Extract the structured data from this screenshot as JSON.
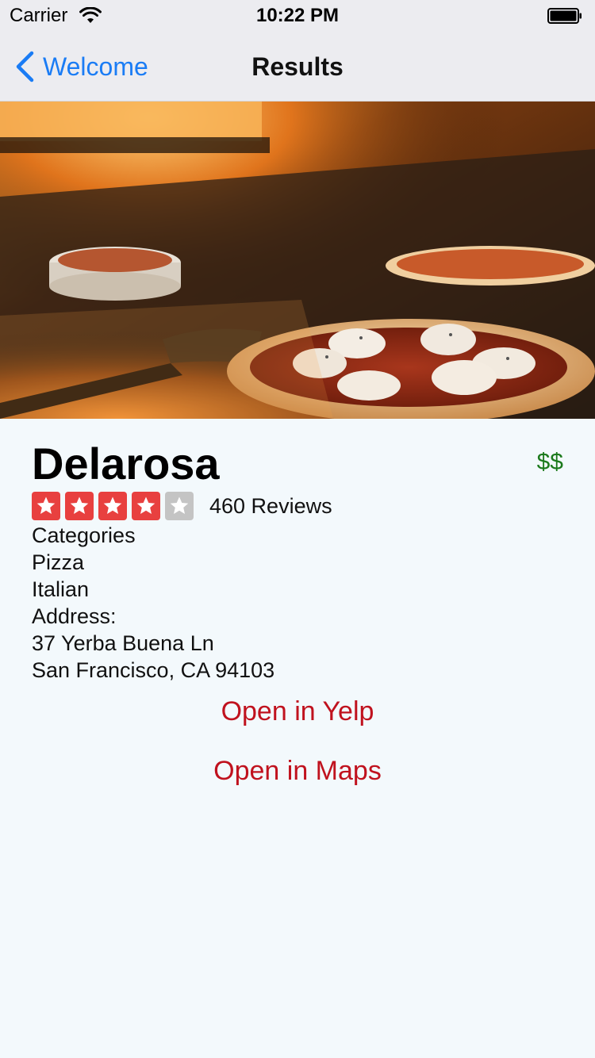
{
  "status_bar": {
    "carrier": "Carrier",
    "time": "10:22 PM"
  },
  "nav": {
    "back_label": "Welcome",
    "title": "Results"
  },
  "business": {
    "name": "Delarosa",
    "price": "$$",
    "rating": 4,
    "rating_max": 5,
    "reviews": "460 Reviews",
    "categories_label": "Categories",
    "categories": [
      "Pizza",
      "Italian"
    ],
    "address_label": "Address:",
    "address_lines": [
      "37 Yerba Buena Ln",
      "San Francisco, CA 94103"
    ]
  },
  "actions": {
    "open_yelp": "Open in Yelp",
    "open_maps": "Open in Maps"
  },
  "colors": {
    "link_red": "#c0121e",
    "ios_blue": "#1a7cf5",
    "price_green": "#1c7a1c",
    "star_active": "#e8403f",
    "star_inactive": "#c4c4c4"
  }
}
